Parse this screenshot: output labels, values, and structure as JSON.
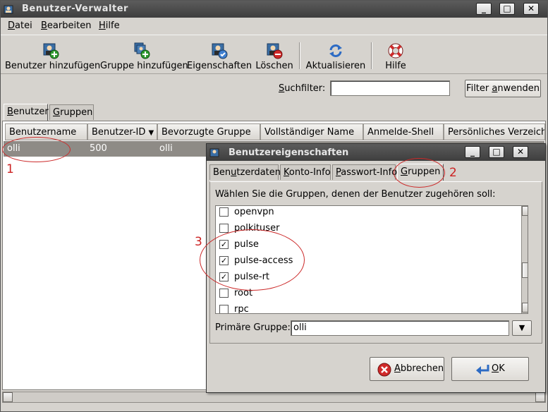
{
  "window": {
    "title": "Benutzer-Verwalter",
    "minimize": "_",
    "maximize": "□",
    "close": "✕"
  },
  "menu": {
    "datei": {
      "u": "D",
      "rest": "atei"
    },
    "bearbeiten": {
      "u": "B",
      "rest": "earbeiten"
    },
    "hilfe": {
      "u": "H",
      "rest": "ilfe"
    }
  },
  "toolbar": {
    "add_user": "Benutzer hinzufügen",
    "add_group": "Gruppe hinzufügen",
    "properties": "Eigenschaften",
    "delete": "Löschen",
    "refresh": "Aktualisieren",
    "help": "Hilfe"
  },
  "filter": {
    "label_u": "S",
    "label_rest": "uchfilter:",
    "value": "",
    "button_pre": "Filter ",
    "button_u": "a",
    "button_post": "nwenden"
  },
  "tabs": {
    "users": {
      "u": "B",
      "rest": "enutzer"
    },
    "groups": {
      "u": "G",
      "rest": "ruppen"
    }
  },
  "table": {
    "columns": [
      "Benutzername",
      "Benutzer-ID",
      "Bevorzugte Gruppe",
      "Vollständiger Name",
      "Anmelde-Shell",
      "Persönliches Verzeichnis"
    ],
    "sort_indicator": "▼",
    "rows": [
      {
        "username": "olli",
        "uid": "500",
        "group": "olli"
      }
    ]
  },
  "annotations": {
    "one": "1",
    "two": "2",
    "three": "3"
  },
  "dialog": {
    "title": "Benutzereigenschaften",
    "tabs": {
      "userdata": {
        "pre": "Ben",
        "u": "u",
        "post": "tzerdaten"
      },
      "account": {
        "pre": "",
        "u": "K",
        "post": "onto-Info"
      },
      "password": {
        "pre": "",
        "u": "P",
        "post": "asswort-Info"
      },
      "groups": {
        "pre": "",
        "u": "G",
        "post": "ruppen"
      }
    },
    "instruction": "Wählen Sie die Gruppen, denen der Benutzer zugehören soll:",
    "groups": [
      {
        "name": "openvpn",
        "checked": false
      },
      {
        "name": "polkituser",
        "checked": false
      },
      {
        "name": "pulse",
        "checked": true
      },
      {
        "name": "pulse-access",
        "checked": true
      },
      {
        "name": "pulse-rt",
        "checked": true
      },
      {
        "name": "root",
        "checked": false
      },
      {
        "name": "rpc",
        "checked": false
      }
    ],
    "check_mark": "✓",
    "primary_label": "Primäre Gruppe:",
    "primary_value": "olli",
    "cancel": {
      "u": "A",
      "rest": "bbrechen"
    },
    "ok": {
      "u": "O",
      "rest": "K"
    }
  }
}
